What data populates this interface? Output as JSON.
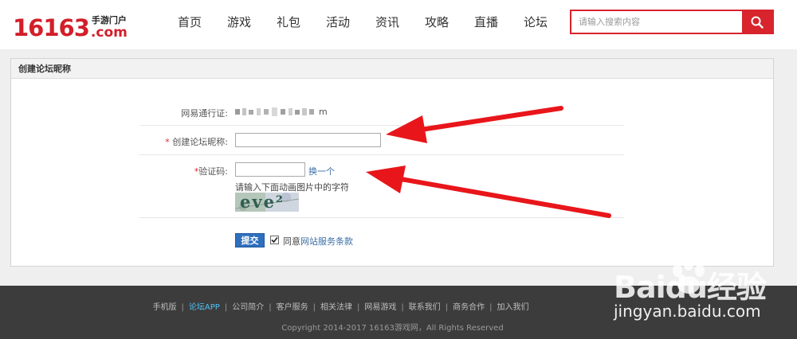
{
  "header": {
    "logo": {
      "number": "16163",
      "cn_text": "手游门户",
      "domain": ".com"
    },
    "nav": [
      "首页",
      "游戏",
      "礼包",
      "活动",
      "资讯",
      "攻略",
      "直播",
      "论坛"
    ],
    "search": {
      "placeholder": "请输入搜索内容",
      "icon": "search-icon"
    }
  },
  "panel": {
    "title": "创建论坛昵称",
    "account_label": "网易通行证:",
    "account_value_suffix": "m",
    "nickname_required_mark": "*",
    "nickname_label": "创建论坛昵称:",
    "nickname_value": "",
    "captcha_required_mark": "*",
    "captcha_label": "验证码:",
    "captcha_value": "",
    "refresh_link": "换一个",
    "captcha_hint": "请输入下面动画图片中的字符",
    "captcha_image_text": "eve²",
    "submit_label": "提交",
    "agree_checked": true,
    "agree_text": "同意",
    "terms_link": "网站服务条款"
  },
  "footer": {
    "links": [
      "手机版",
      "论坛APP",
      "公司简介",
      "客户服务",
      "相关法律",
      "网易游戏",
      "联系我们",
      "商务合作",
      "加入我们"
    ],
    "active_link": "论坛APP",
    "separator": "|",
    "copyright": "Copyright 2014-2017   16163游戏网，All Rights Reserved"
  },
  "watermark": {
    "brand": "Baidu经验",
    "url": "jingyan.baidu.com"
  },
  "colors": {
    "brand_red": "#d21f2a",
    "link_blue": "#3b6ea5",
    "submit_blue": "#2e6fbe",
    "annotation_arrow": "#e8161b"
  }
}
